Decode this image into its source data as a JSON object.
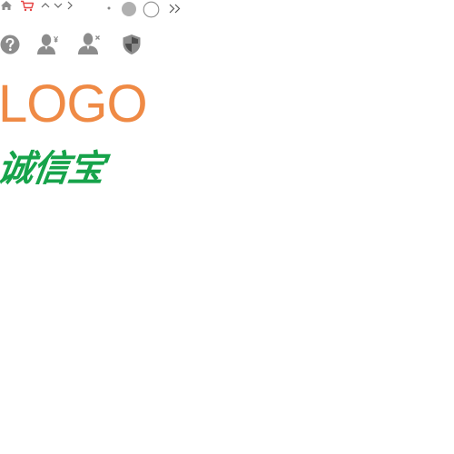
{
  "colors": {
    "icon_gray": "#8c8c8c",
    "cart_red": "#e64545",
    "logo_orange": "#ef8a45",
    "brand_green": "#16a34a"
  },
  "sprite_row_1": {
    "icons": [
      "home-icon",
      "cart-icon",
      "chevron-up-icon",
      "chevron-down-icon",
      "chevron-right-icon",
      "dot-icon",
      "filled-circle-icon",
      "empty-circle-icon",
      "double-chevron-right-icon"
    ]
  },
  "sprite_row_2": {
    "icons": [
      "help-icon",
      "user-yen-icon",
      "user-remove-icon",
      "shield-icon"
    ]
  },
  "logo": {
    "text": "LOGO"
  },
  "brand": {
    "text": "诚信宝"
  }
}
